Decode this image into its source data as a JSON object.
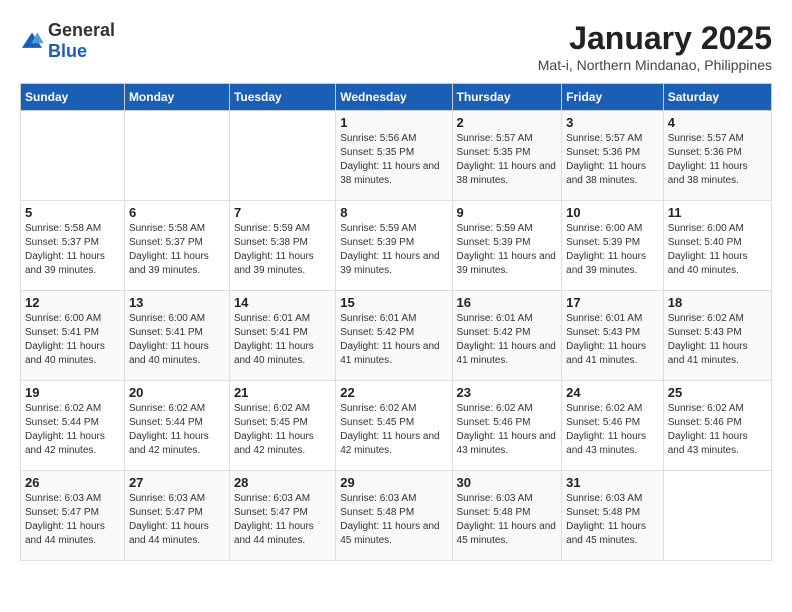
{
  "logo": {
    "general": "General",
    "blue": "Blue"
  },
  "title": "January 2025",
  "subtitle": "Mat-i, Northern Mindanao, Philippines",
  "days_of_week": [
    "Sunday",
    "Monday",
    "Tuesday",
    "Wednesday",
    "Thursday",
    "Friday",
    "Saturday"
  ],
  "weeks": [
    [
      {
        "day": "",
        "info": ""
      },
      {
        "day": "",
        "info": ""
      },
      {
        "day": "",
        "info": ""
      },
      {
        "day": "1",
        "info": "Sunrise: 5:56 AM\nSunset: 5:35 PM\nDaylight: 11 hours and 38 minutes."
      },
      {
        "day": "2",
        "info": "Sunrise: 5:57 AM\nSunset: 5:35 PM\nDaylight: 11 hours and 38 minutes."
      },
      {
        "day": "3",
        "info": "Sunrise: 5:57 AM\nSunset: 5:36 PM\nDaylight: 11 hours and 38 minutes."
      },
      {
        "day": "4",
        "info": "Sunrise: 5:57 AM\nSunset: 5:36 PM\nDaylight: 11 hours and 38 minutes."
      }
    ],
    [
      {
        "day": "5",
        "info": "Sunrise: 5:58 AM\nSunset: 5:37 PM\nDaylight: 11 hours and 39 minutes."
      },
      {
        "day": "6",
        "info": "Sunrise: 5:58 AM\nSunset: 5:37 PM\nDaylight: 11 hours and 39 minutes."
      },
      {
        "day": "7",
        "info": "Sunrise: 5:59 AM\nSunset: 5:38 PM\nDaylight: 11 hours and 39 minutes."
      },
      {
        "day": "8",
        "info": "Sunrise: 5:59 AM\nSunset: 5:39 PM\nDaylight: 11 hours and 39 minutes."
      },
      {
        "day": "9",
        "info": "Sunrise: 5:59 AM\nSunset: 5:39 PM\nDaylight: 11 hours and 39 minutes."
      },
      {
        "day": "10",
        "info": "Sunrise: 6:00 AM\nSunset: 5:39 PM\nDaylight: 11 hours and 39 minutes."
      },
      {
        "day": "11",
        "info": "Sunrise: 6:00 AM\nSunset: 5:40 PM\nDaylight: 11 hours and 40 minutes."
      }
    ],
    [
      {
        "day": "12",
        "info": "Sunrise: 6:00 AM\nSunset: 5:41 PM\nDaylight: 11 hours and 40 minutes."
      },
      {
        "day": "13",
        "info": "Sunrise: 6:00 AM\nSunset: 5:41 PM\nDaylight: 11 hours and 40 minutes."
      },
      {
        "day": "14",
        "info": "Sunrise: 6:01 AM\nSunset: 5:41 PM\nDaylight: 11 hours and 40 minutes."
      },
      {
        "day": "15",
        "info": "Sunrise: 6:01 AM\nSunset: 5:42 PM\nDaylight: 11 hours and 41 minutes."
      },
      {
        "day": "16",
        "info": "Sunrise: 6:01 AM\nSunset: 5:42 PM\nDaylight: 11 hours and 41 minutes."
      },
      {
        "day": "17",
        "info": "Sunrise: 6:01 AM\nSunset: 5:43 PM\nDaylight: 11 hours and 41 minutes."
      },
      {
        "day": "18",
        "info": "Sunrise: 6:02 AM\nSunset: 5:43 PM\nDaylight: 11 hours and 41 minutes."
      }
    ],
    [
      {
        "day": "19",
        "info": "Sunrise: 6:02 AM\nSunset: 5:44 PM\nDaylight: 11 hours and 42 minutes."
      },
      {
        "day": "20",
        "info": "Sunrise: 6:02 AM\nSunset: 5:44 PM\nDaylight: 11 hours and 42 minutes."
      },
      {
        "day": "21",
        "info": "Sunrise: 6:02 AM\nSunset: 5:45 PM\nDaylight: 11 hours and 42 minutes."
      },
      {
        "day": "22",
        "info": "Sunrise: 6:02 AM\nSunset: 5:45 PM\nDaylight: 11 hours and 42 minutes."
      },
      {
        "day": "23",
        "info": "Sunrise: 6:02 AM\nSunset: 5:46 PM\nDaylight: 11 hours and 43 minutes."
      },
      {
        "day": "24",
        "info": "Sunrise: 6:02 AM\nSunset: 5:46 PM\nDaylight: 11 hours and 43 minutes."
      },
      {
        "day": "25",
        "info": "Sunrise: 6:02 AM\nSunset: 5:46 PM\nDaylight: 11 hours and 43 minutes."
      }
    ],
    [
      {
        "day": "26",
        "info": "Sunrise: 6:03 AM\nSunset: 5:47 PM\nDaylight: 11 hours and 44 minutes."
      },
      {
        "day": "27",
        "info": "Sunrise: 6:03 AM\nSunset: 5:47 PM\nDaylight: 11 hours and 44 minutes."
      },
      {
        "day": "28",
        "info": "Sunrise: 6:03 AM\nSunset: 5:47 PM\nDaylight: 11 hours and 44 minutes."
      },
      {
        "day": "29",
        "info": "Sunrise: 6:03 AM\nSunset: 5:48 PM\nDaylight: 11 hours and 45 minutes."
      },
      {
        "day": "30",
        "info": "Sunrise: 6:03 AM\nSunset: 5:48 PM\nDaylight: 11 hours and 45 minutes."
      },
      {
        "day": "31",
        "info": "Sunrise: 6:03 AM\nSunset: 5:48 PM\nDaylight: 11 hours and 45 minutes."
      },
      {
        "day": "",
        "info": ""
      }
    ]
  ]
}
